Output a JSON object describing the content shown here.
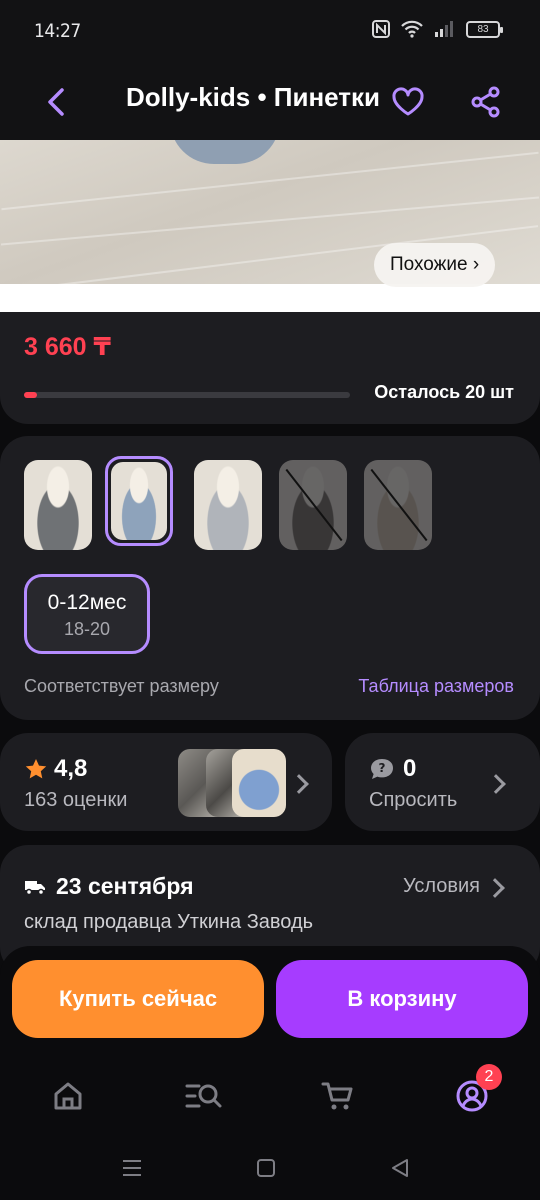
{
  "status_bar": {
    "time": "14:27",
    "battery": "83"
  },
  "header": {
    "title": "Dolly-kids • Пинетки"
  },
  "hero": {
    "similar_label": "Похожие ›"
  },
  "price": {
    "value": "3 660 ₸",
    "stock_text": "Осталось 20 шт",
    "stock_level_percent": 4
  },
  "variants": {
    "thumbnails": [
      {
        "name": "gray-booties",
        "color": "#6f7275",
        "selected": false,
        "available": true
      },
      {
        "name": "blue-booties",
        "color": "#8ea3bb",
        "selected": true,
        "available": true
      },
      {
        "name": "silver-booties",
        "color": "#b0b4ba",
        "selected": false,
        "available": true
      },
      {
        "name": "dark-booties",
        "color": "#6d6760",
        "selected": false,
        "available": false
      },
      {
        "name": "beige-booties",
        "color": "#c9bba6",
        "selected": false,
        "available": false
      }
    ],
    "size": {
      "label": "0-12мес",
      "sub": "18-20"
    },
    "fits_text": "Соответствует размеру",
    "size_table_link": "Таблица размеров"
  },
  "rating": {
    "value": "4,8",
    "count_text": "163 оценки"
  },
  "questions": {
    "count": "0",
    "label": "Спросить"
  },
  "delivery": {
    "date": "23 сентября",
    "terms": "Условия",
    "place": "склад продавца Уткина Заводь"
  },
  "actions": {
    "buy_now": "Купить сейчас",
    "add_to_cart": "В корзину"
  },
  "tab_bar": {
    "profile_badge": "2"
  },
  "colors": {
    "accent": "#b58cff",
    "price": "#ff4152",
    "buy": "#ff8f2f",
    "cart": "#a63cff"
  }
}
